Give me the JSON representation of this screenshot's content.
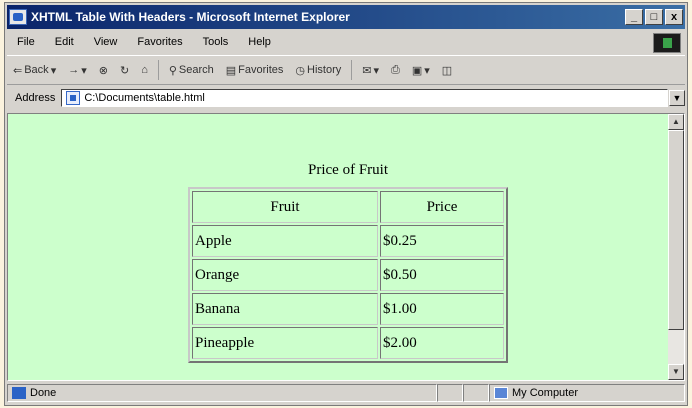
{
  "window": {
    "title": "XHTML Table With Headers - Microsoft Internet Explorer",
    "controls": [
      "_",
      "□",
      "x"
    ]
  },
  "menu": [
    "File",
    "Edit",
    "View",
    "Favorites",
    "Tools",
    "Help"
  ],
  "toolbar": {
    "back": "Back",
    "forward": "→",
    "search": "Search",
    "favorites": "Favorites",
    "history": "History"
  },
  "address": {
    "label": "Address",
    "value": "C:\\Documents\\table.html"
  },
  "table": {
    "caption": "Price of Fruit",
    "headers": [
      "Fruit",
      "Price"
    ],
    "rows": [
      [
        "Apple",
        "$0.25"
      ],
      [
        "Orange",
        "$0.50"
      ],
      [
        "Banana",
        "$1.00"
      ],
      [
        "Pineapple",
        "$2.00"
      ]
    ]
  },
  "status": {
    "text": "Done",
    "zone": "My Computer"
  }
}
